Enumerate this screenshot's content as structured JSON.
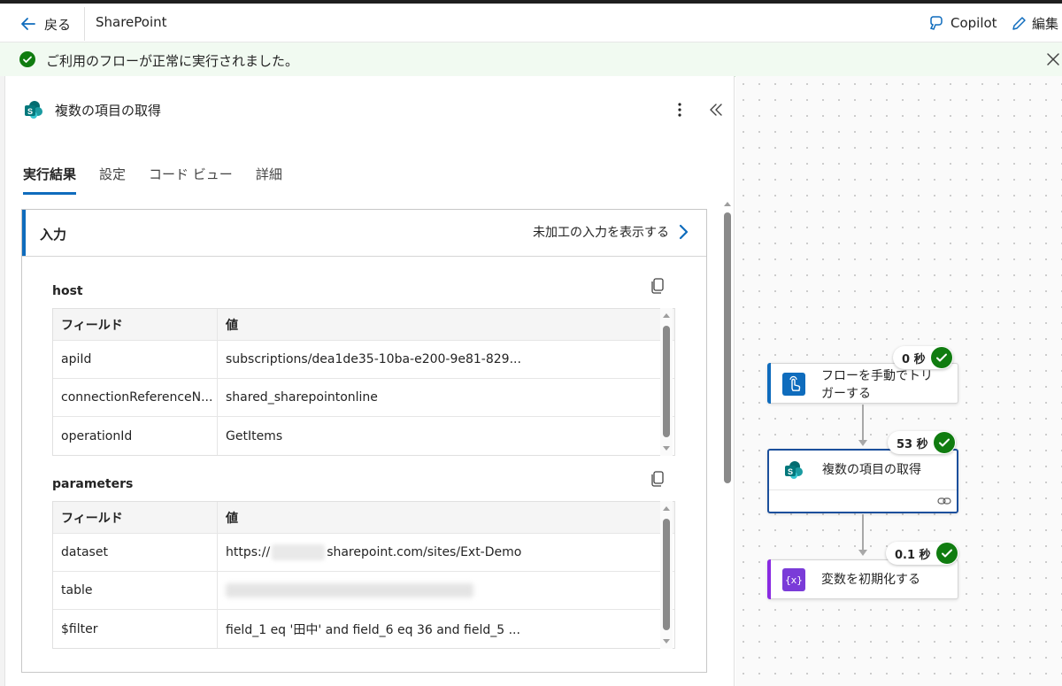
{
  "topbar": {
    "back_label": "戻る",
    "app_title": "SharePoint",
    "copilot_label": "Copilot",
    "edit_label": "編集"
  },
  "banner": {
    "message": "ご利用のフローが正常に実行されました。",
    "status_color": "#107c10"
  },
  "panel": {
    "title": "複数の項目の取得",
    "tabs": [
      {
        "label": "実行結果",
        "active": true
      },
      {
        "label": "設定",
        "active": false
      },
      {
        "label": "コード ビュー",
        "active": false
      },
      {
        "label": "詳細",
        "active": false
      }
    ],
    "input_card": {
      "title": "入力",
      "raw_link": "未加工の入力を表示する",
      "sections": [
        {
          "label": "host",
          "header": {
            "field": "フィールド",
            "value": "値"
          },
          "rows": [
            {
              "field": "apiId",
              "value": "subscriptions/dea1de35-10ba-e200-9e81-829..."
            },
            {
              "field": "connectionReferenceN...",
              "value": "shared_sharepointonline"
            },
            {
              "field": "operationId",
              "value": "GetItems"
            }
          ]
        },
        {
          "label": "parameters",
          "header": {
            "field": "フィールド",
            "value": "値"
          },
          "rows": [
            {
              "field": "dataset",
              "value_prefix": "https://",
              "value_suffix": "sharepoint.com/sites/Ext-Demo"
            },
            {
              "field": "table",
              "value": ""
            },
            {
              "field": "$filter",
              "value": "field_1 eq '田中' and field_6 eq 36 and field_5 ..."
            }
          ]
        }
      ]
    }
  },
  "flow": {
    "nodes": [
      {
        "label_line1": "フローを手動でトリ",
        "label_line2": "ガーする",
        "duration": "0 秒",
        "icon": "trigger-hand-icon",
        "color": "#0f6cbd"
      },
      {
        "label_line1": "複数の項目の取得",
        "duration": "53 秒",
        "icon": "sharepoint-icon",
        "color": "#03787c"
      },
      {
        "label_line1": "変数を初期化する",
        "duration": "0.1 秒",
        "icon": "variable-icon",
        "color": "#8a2be2"
      }
    ]
  }
}
